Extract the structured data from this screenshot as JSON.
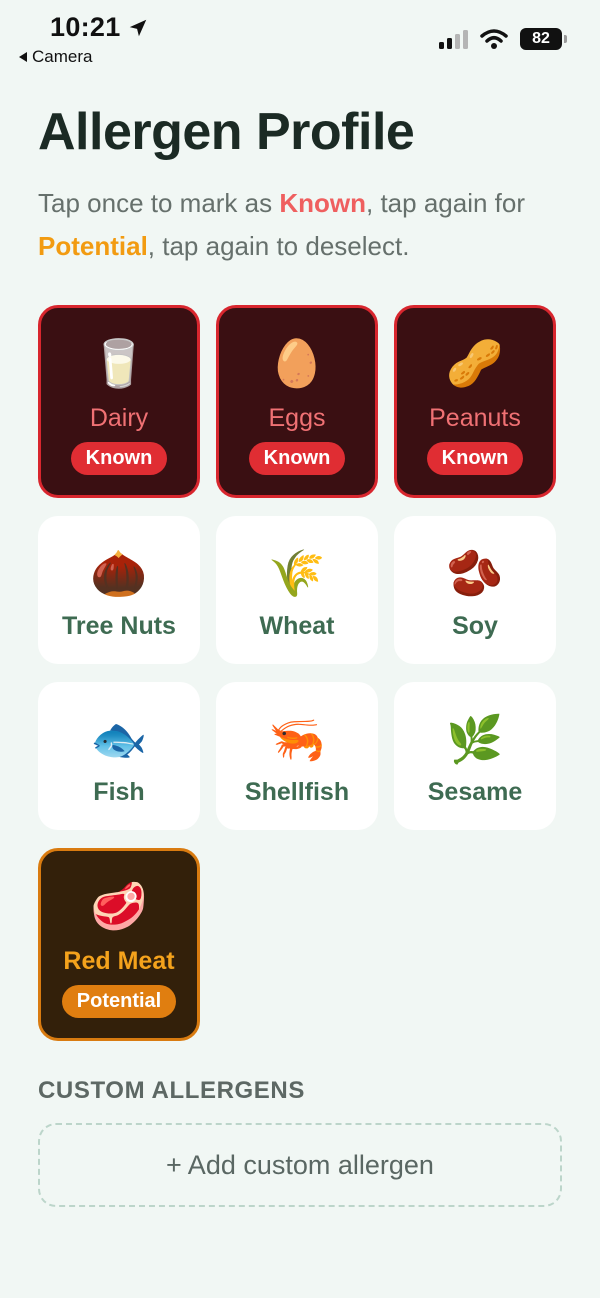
{
  "status_bar": {
    "time": "10:21",
    "back_label": "Camera",
    "battery": "82"
  },
  "header": {
    "title": "Allergen Profile",
    "instructions": {
      "part1": "Tap once to mark as ",
      "known_word": "Known",
      "part2": ", tap again for ",
      "potential_word": "Potential",
      "part3": ", tap again to deselect."
    }
  },
  "allergens": [
    {
      "label": "Dairy",
      "emoji": "🥛",
      "state": "known",
      "badge": "Known"
    },
    {
      "label": "Eggs",
      "emoji": "🥚",
      "state": "known",
      "badge": "Known"
    },
    {
      "label": "Peanuts",
      "emoji": "🥜",
      "state": "known",
      "badge": "Known"
    },
    {
      "label": "Tree Nuts",
      "emoji": "🌰",
      "state": "none"
    },
    {
      "label": "Wheat",
      "emoji": "🌾",
      "state": "none"
    },
    {
      "label": "Soy",
      "emoji": "🫘",
      "state": "none"
    },
    {
      "label": "Fish",
      "emoji": "🐟",
      "state": "none"
    },
    {
      "label": "Shellfish",
      "emoji": "🦐",
      "state": "none"
    },
    {
      "label": "Sesame",
      "emoji": "🌿",
      "state": "none"
    },
    {
      "label": "Red Meat",
      "emoji": "🥩",
      "state": "potential",
      "badge": "Potential"
    }
  ],
  "custom": {
    "heading": "CUSTOM ALLERGENS",
    "add_button": "+ Add custom allergen"
  },
  "colors": {
    "background": "#f1f7f4",
    "known_accent": "#e02d33",
    "potential_accent": "#e07e10",
    "label_green": "#3e6b52"
  }
}
